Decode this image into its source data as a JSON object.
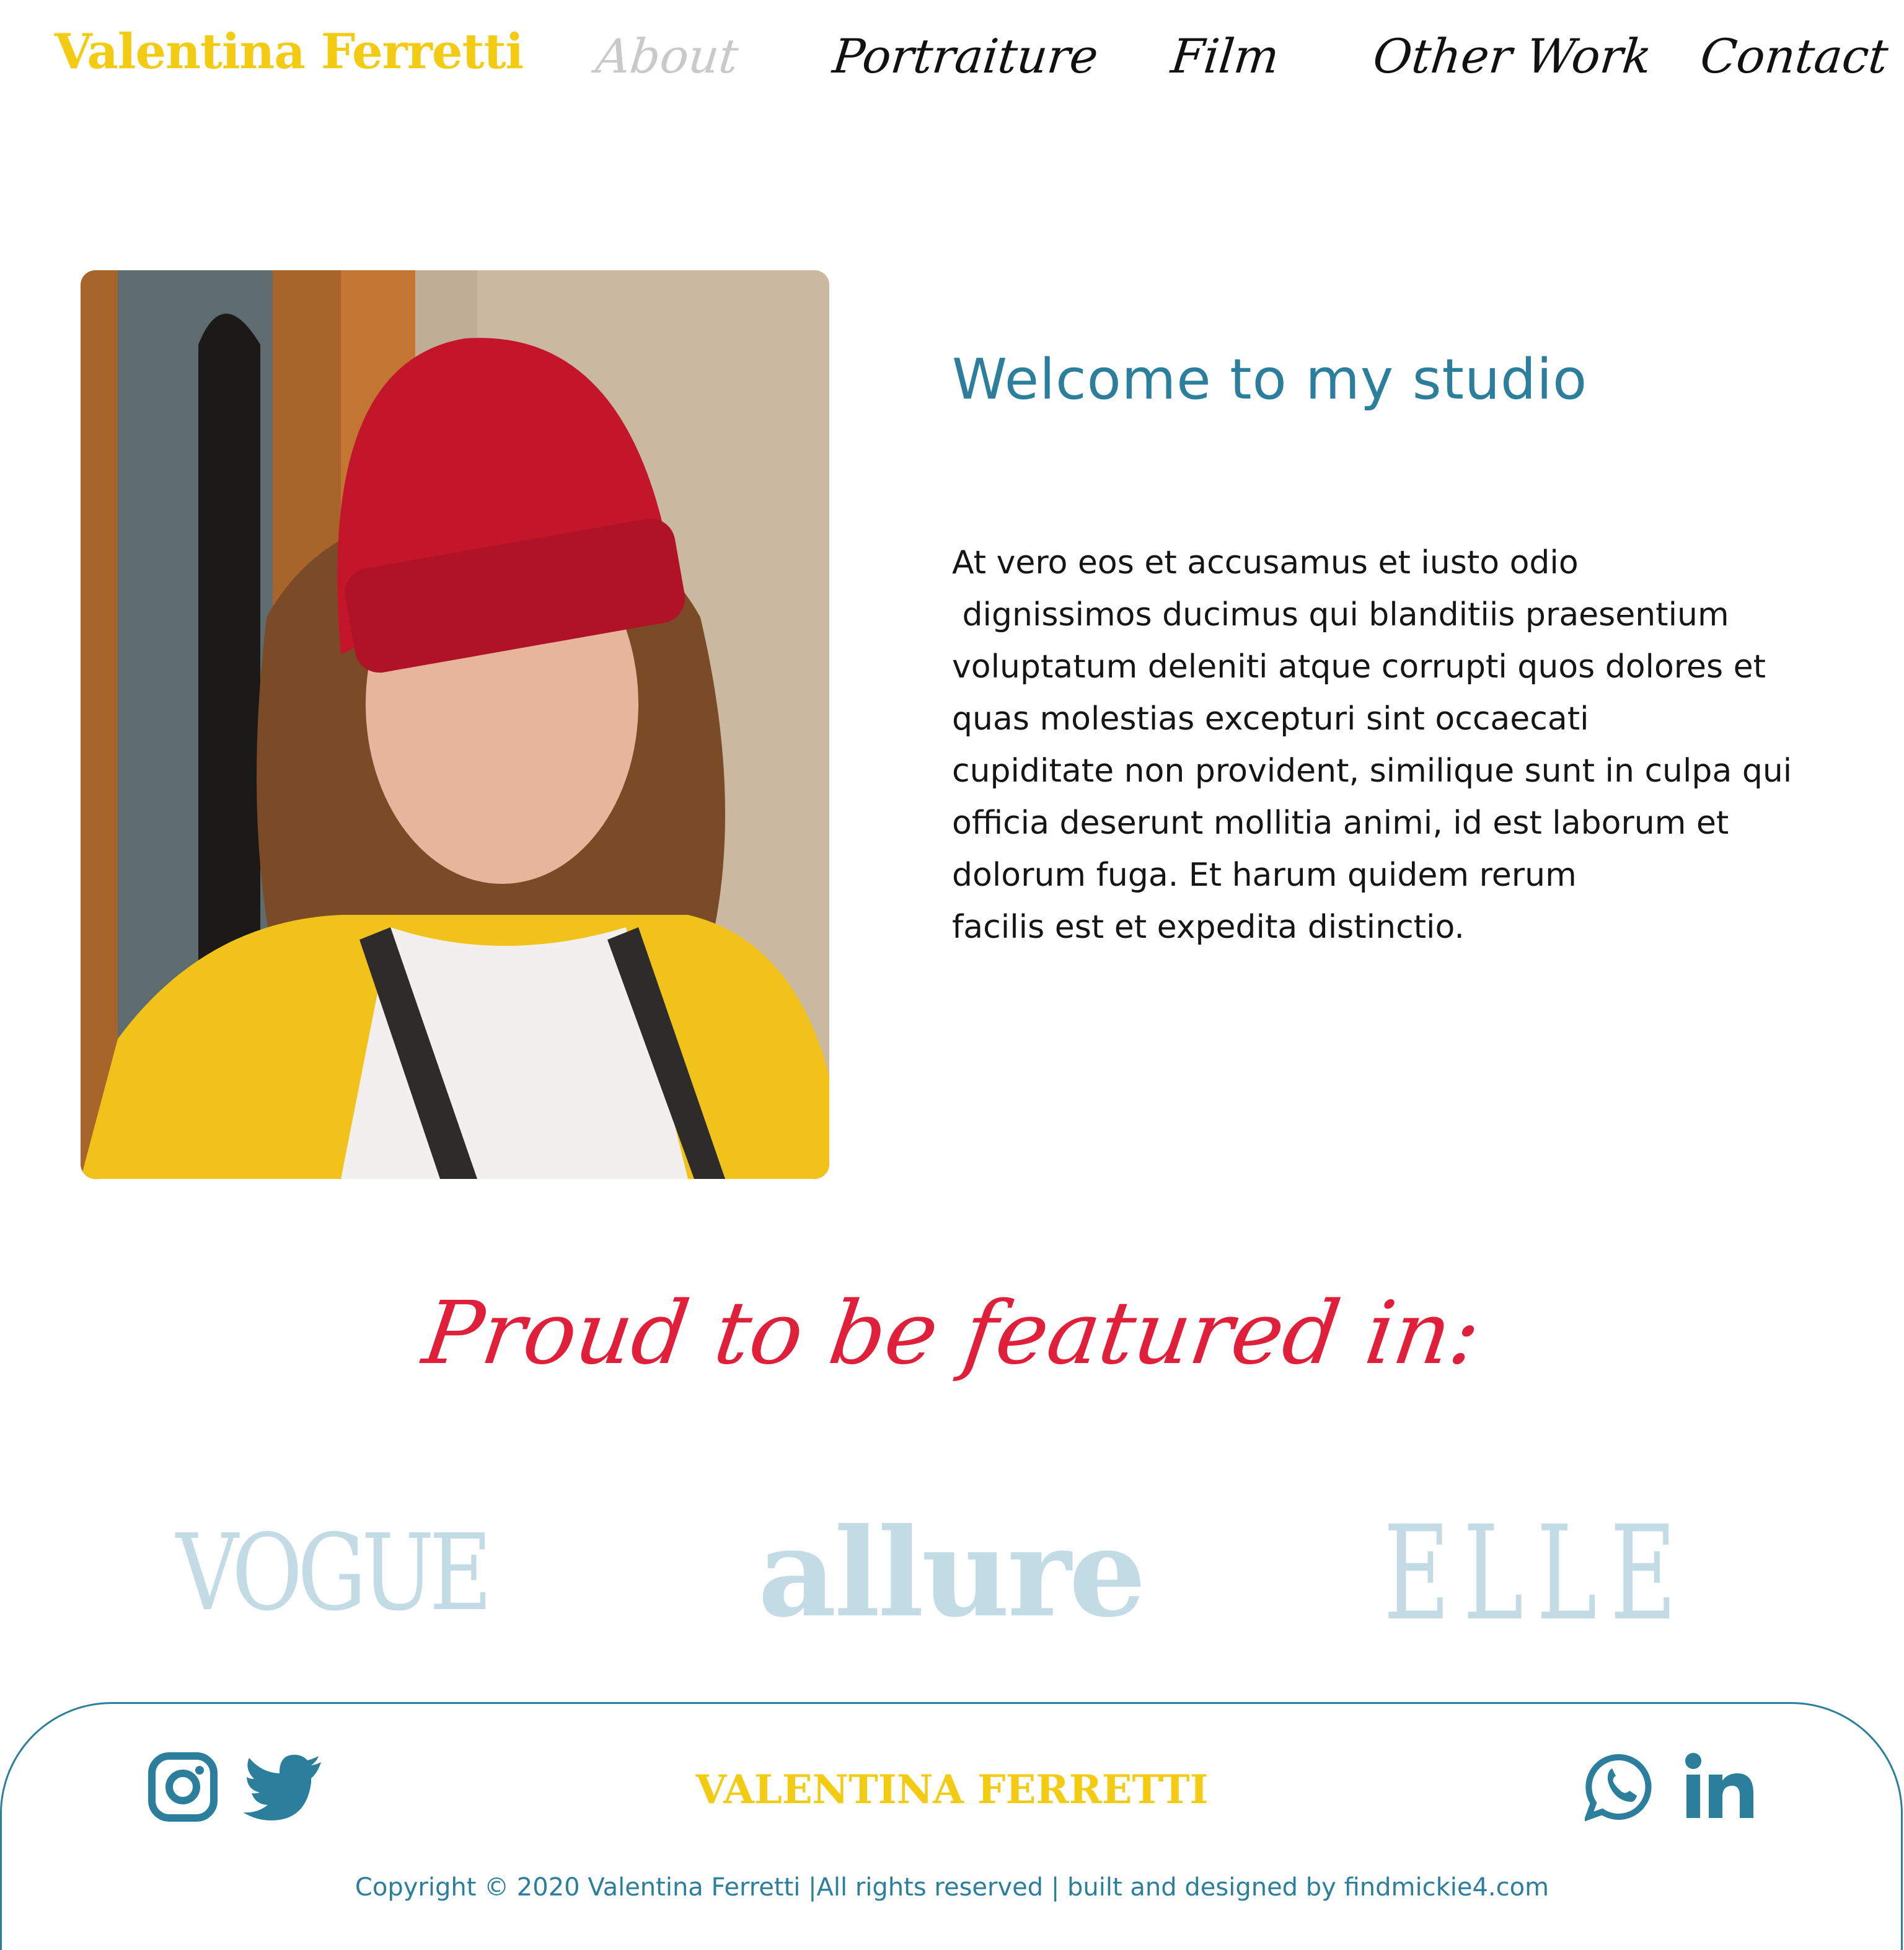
{
  "header": {
    "brand": "Valentina Ferretti",
    "nav": [
      {
        "label": "About",
        "active": true
      },
      {
        "label": "Portraiture"
      },
      {
        "label": "Film"
      },
      {
        "label": "Other Work"
      },
      {
        "label": "Contact"
      }
    ]
  },
  "intro": {
    "heading": "Welcome to my studio",
    "body_lines": [
      "At vero eos et accusamus et iusto odio",
      " dignissimos ducimus qui blanditiis praesentium",
      "voluptatum deleniti atque corrupti quos dolores et",
      "quas molestias excepturi sint occaecati",
      "cupiditate non provident, similique sunt in culpa qui",
      "officia deserunt mollitia animi, id est laborum et",
      "dolorum fuga. Et harum quidem rerum",
      "facilis est et expedita distinctio."
    ]
  },
  "featured": {
    "heading": "Proud to be featured in:",
    "logos": [
      "VOGUE",
      "allure",
      "ELLE"
    ]
  },
  "footer": {
    "name": "VALENTINA FERRETTI",
    "copyright": "Copyright © 2020 Valentina Ferretti |All rights reserved | built and designed by findmickie4.com",
    "social": [
      "instagram-icon",
      "twitter-icon",
      "whatsapp-icon",
      "linkedin-icon"
    ]
  },
  "colors": {
    "brand_yellow": "#f2cb12",
    "accent_blue": "#2b7e9c",
    "feature_red": "#e01f3a",
    "logo_blue": "#c3dbe5"
  }
}
